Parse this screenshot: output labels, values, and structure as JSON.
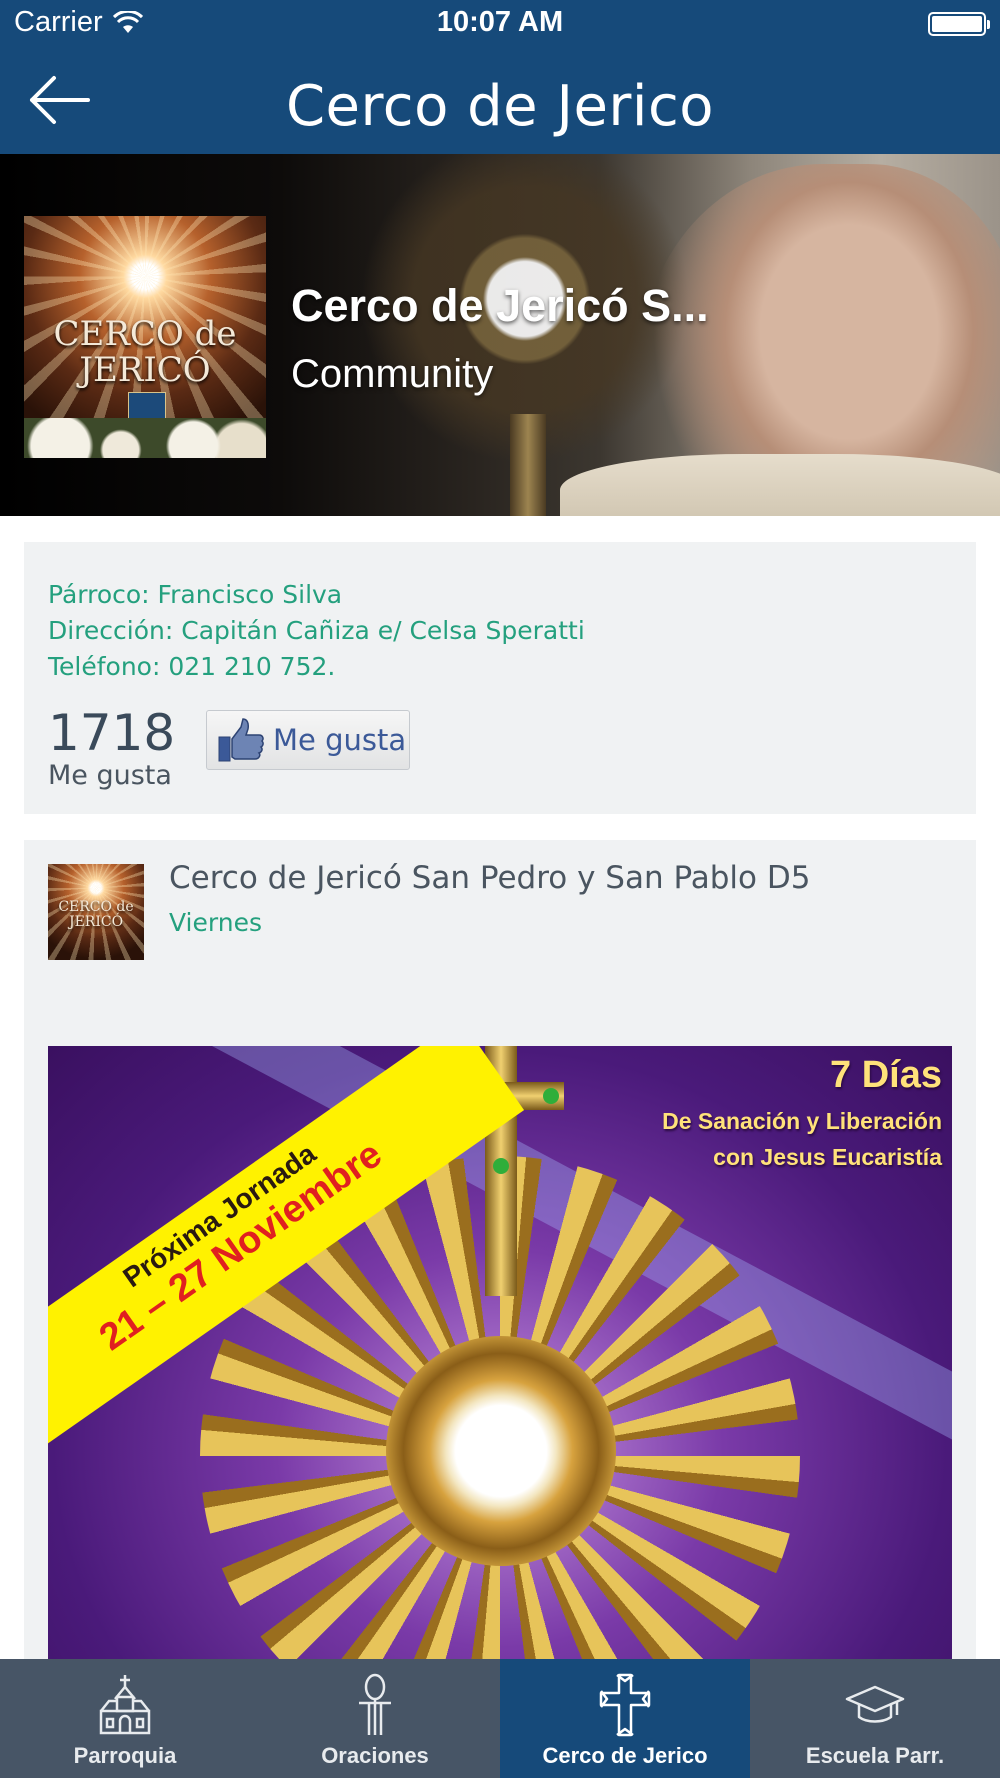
{
  "status_bar": {
    "carrier": "Carrier",
    "time": "10:07 AM",
    "battery_level": 1.0
  },
  "nav": {
    "title": "Cerco de Jerico",
    "back_icon": "arrow-left-icon"
  },
  "hero": {
    "cover_title": "CERCO de JERICÓ",
    "name": "Cerco de Jericó S...",
    "category": "Community"
  },
  "info": {
    "parroco": "Párroco: Francisco Silva",
    "direccion": "Dirección: Capitán Cañiza e/ Celsa Speratti",
    "telefono": "Teléfono: 021 210 752.",
    "likes_count": "1718",
    "likes_label": "Me gusta",
    "like_button_label": "Me gusta",
    "like_button_icon": "thumbs-up-icon"
  },
  "post": {
    "title": "Cerco de Jericó San Pedro y San Pablo D5",
    "subtitle": "Viernes",
    "poster": {
      "banner_line1": "Próxima Jornada",
      "banner_line2": "21 – 27 Noviembre",
      "days": "7 Días",
      "line1": "De Sanación y Liberación",
      "line2": "con Jesus Eucaristía"
    }
  },
  "tabs": [
    {
      "label": "Parroquia",
      "icon": "church-icon",
      "active": false
    },
    {
      "label": "Oraciones",
      "icon": "ankh-icon",
      "active": false
    },
    {
      "label": "Cerco de Jerico",
      "icon": "cross-icon",
      "active": true
    },
    {
      "label": "Escuela Parr.",
      "icon": "graduation-cap-icon",
      "active": false
    }
  ],
  "colors": {
    "nav_background": "#164a7a",
    "accent_green": "#24a07e",
    "tabbar_background": "#475566",
    "card_background": "#f0f2f3"
  }
}
